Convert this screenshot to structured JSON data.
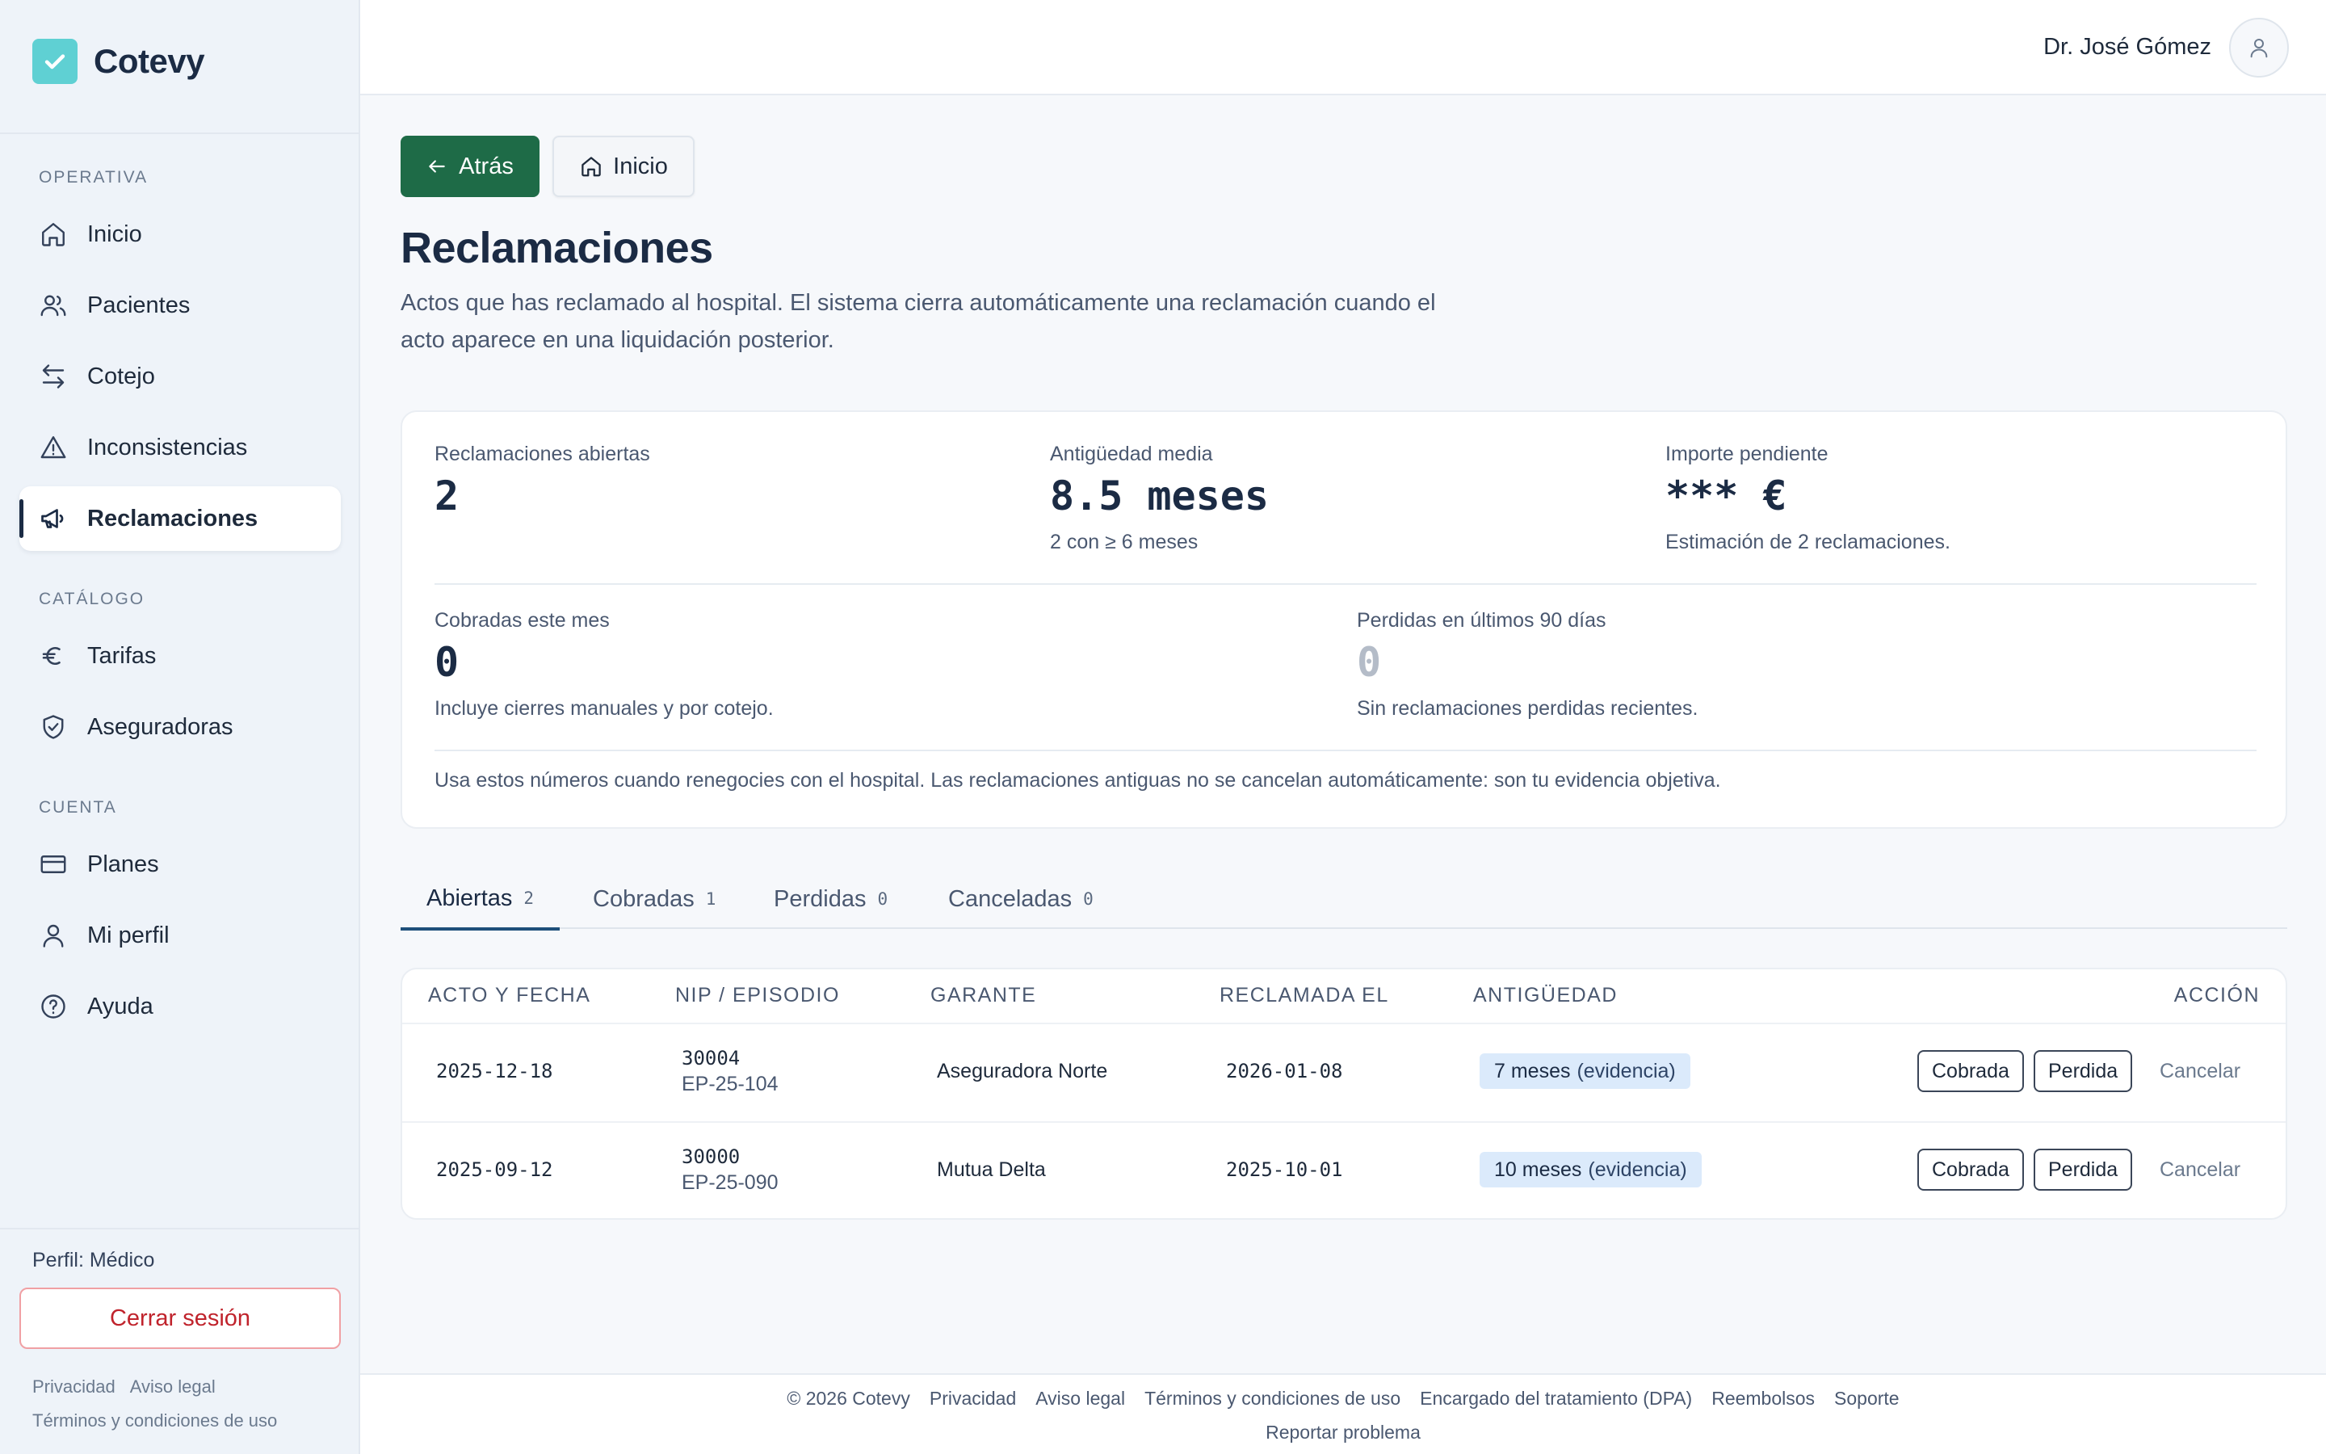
{
  "brand": {
    "name": "Cotevy"
  },
  "sidebar": {
    "sections": [
      {
        "title": "OPERATIVA",
        "items": [
          {
            "label": "Inicio",
            "icon": "home-icon"
          },
          {
            "label": "Pacientes",
            "icon": "users-icon"
          },
          {
            "label": "Cotejo",
            "icon": "arrows-swap-icon"
          },
          {
            "label": "Inconsistencias",
            "icon": "warning-icon"
          },
          {
            "label": "Reclamaciones",
            "icon": "megaphone-icon",
            "active": true
          }
        ]
      },
      {
        "title": "CATÁLOGO",
        "items": [
          {
            "label": "Tarifas",
            "icon": "euro-icon"
          },
          {
            "label": "Aseguradoras",
            "icon": "shield-icon"
          }
        ]
      },
      {
        "title": "CUENTA",
        "items": [
          {
            "label": "Planes",
            "icon": "credit-card-icon"
          },
          {
            "label": "Mi perfil",
            "icon": "user-icon"
          },
          {
            "label": "Ayuda",
            "icon": "help-icon"
          }
        ]
      }
    ],
    "profile": "Perfil: Médico",
    "logout": "Cerrar sesión",
    "legal": [
      "Privacidad",
      "Aviso legal",
      "Términos y condiciones de uso"
    ]
  },
  "header": {
    "user": "Dr. José Gómez"
  },
  "nav": {
    "back": "Atrás",
    "home": "Inicio"
  },
  "page": {
    "title": "Reclamaciones",
    "subtitle": "Actos que has reclamado al hospital. El sistema cierra automáticamente una reclamación cuando el acto aparece en una liquidación posterior."
  },
  "stats": {
    "open": {
      "label": "Reclamaciones abiertas",
      "value": "2"
    },
    "age": {
      "label": "Antigüedad media",
      "value": "8.5 meses",
      "note": "2 con ≥ 6 meses"
    },
    "pending": {
      "label": "Importe pendiente",
      "value": "*** €",
      "note": "Estimación de 2 reclamaciones."
    },
    "collected": {
      "label": "Cobradas este mes",
      "value": "0",
      "note": "Incluye cierres manuales y por cotejo."
    },
    "lost": {
      "label": "Perdidas en últimos 90 días",
      "value": "0",
      "note": "Sin reclamaciones perdidas recientes."
    },
    "footnote": "Usa estos números cuando renegocies con el hospital. Las reclamaciones antiguas no se cancelan automáticamente: son tu evidencia objetiva."
  },
  "tabs": [
    {
      "label": "Abiertas",
      "count": "2",
      "active": true
    },
    {
      "label": "Cobradas",
      "count": "1"
    },
    {
      "label": "Perdidas",
      "count": "0"
    },
    {
      "label": "Canceladas",
      "count": "0"
    }
  ],
  "table": {
    "headers": [
      "ACTO Y FECHA",
      "NIP / EPISODIO",
      "GARANTE",
      "RECLAMADA EL",
      "ANTIGÜEDAD",
      "ACCIÓN"
    ],
    "rows": [
      {
        "date": "2025-12-18",
        "nip": "30004",
        "episode": "EP-25-104",
        "payer": "Aseguradora Norte",
        "claimed": "2026-01-08",
        "age": "7 meses",
        "evidence": "(evidencia)"
      },
      {
        "date": "2025-09-12",
        "nip": "30000",
        "episode": "EP-25-090",
        "payer": "Mutua Delta",
        "claimed": "2025-10-01",
        "age": "10 meses",
        "evidence": "(evidencia)"
      }
    ],
    "actions": {
      "paid": "Cobrada",
      "lost": "Perdida",
      "cancel": "Cancelar"
    }
  },
  "footer": {
    "links": [
      "© 2026 Cotevy",
      "Privacidad",
      "Aviso legal",
      "Términos y condiciones de uso",
      "Encargado del tratamiento (DPA)",
      "Reembolsos",
      "Soporte"
    ],
    "report": "Reportar problema"
  }
}
